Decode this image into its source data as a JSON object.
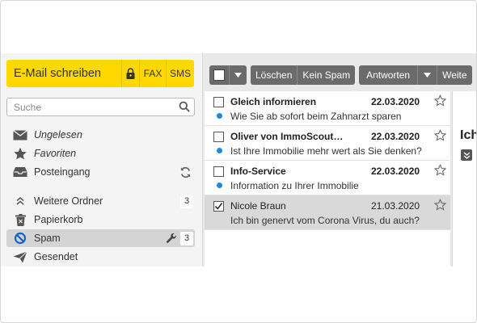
{
  "compose": {
    "write_label": "E-Mail schreiben",
    "fax_label": "FAX",
    "sms_label": "SMS"
  },
  "search": {
    "placeholder": "Suche"
  },
  "folders": [
    {
      "label": "Ungelesen",
      "icon": "envelope-icon"
    },
    {
      "label": "Favoriten",
      "icon": "star-icon"
    },
    {
      "label": "Posteingang",
      "icon": "inbox-icon"
    },
    {
      "label": "Weitere Ordner",
      "icon": "chevron-up-icon",
      "count": "3"
    },
    {
      "label": "Papierkorb",
      "icon": "trash-icon"
    },
    {
      "label": "Spam",
      "icon": "spam-icon",
      "count": "3"
    },
    {
      "label": "Gesendet",
      "icon": "send-icon"
    }
  ],
  "toolbar": {
    "delete_label": "Löschen",
    "not_spam_label": "Kein Spam",
    "reply_label": "Antworten",
    "forward_label": "Weite"
  },
  "mails": [
    {
      "sender": "Gleich informieren",
      "date": "22.03.2020",
      "subject": "Wie Sie ab sofort beim Zahnarzt sparen",
      "unread": true,
      "checked": false
    },
    {
      "sender": "Oliver von ImmoScout…",
      "date": "22.03.2020",
      "subject": "Ist Ihre Immobilie mehr wert als Sie denken?",
      "unread": true,
      "checked": false
    },
    {
      "sender": "Info-Service",
      "date": "22.03.2020",
      "subject": "Information zu Ihrer Immobilie",
      "unread": true,
      "checked": false
    },
    {
      "sender": "Nicole Braun",
      "date": "21.03.2020",
      "subject": "Ich bin genervt vom Corona Virus, du auch?",
      "unread": false,
      "checked": true
    }
  ],
  "reading": {
    "title": "Ich"
  },
  "colors": {
    "accent": "#ffd800",
    "toolbar": "#6b6b6b",
    "unread_dot": "#1e88e5",
    "spam_icon": "#1565c0"
  }
}
